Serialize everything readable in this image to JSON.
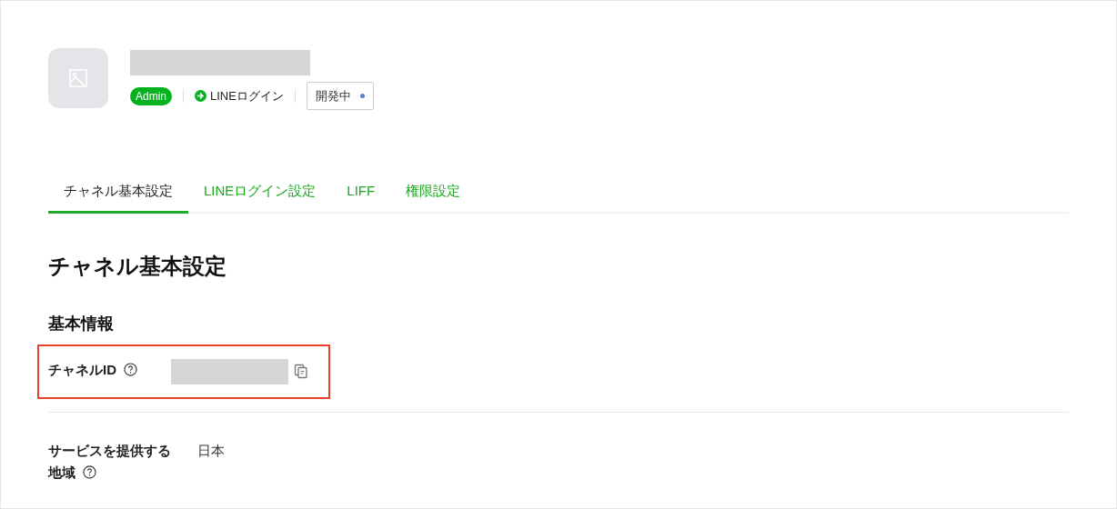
{
  "channel": {
    "role_badge": "Admin",
    "type": "LINEログイン",
    "status": {
      "label": "開発中",
      "color": "#5b7fd6"
    }
  },
  "tabs": [
    {
      "label": "チャネル基本設定",
      "selected": true
    },
    {
      "label": "LINEログイン設定",
      "selected": false
    },
    {
      "label": "LIFF",
      "selected": false
    },
    {
      "label": "権限設定",
      "selected": false
    }
  ],
  "page_title": "チャネル基本設定",
  "section_title": "基本情報",
  "fields": [
    {
      "kind": "redacted",
      "label": "チャネルID",
      "help": true,
      "copy": true,
      "highlighted": true
    },
    {
      "kind": "text",
      "label": "サービスを提供する地域",
      "help": true,
      "value": "日本",
      "highlighted": false
    }
  ]
}
